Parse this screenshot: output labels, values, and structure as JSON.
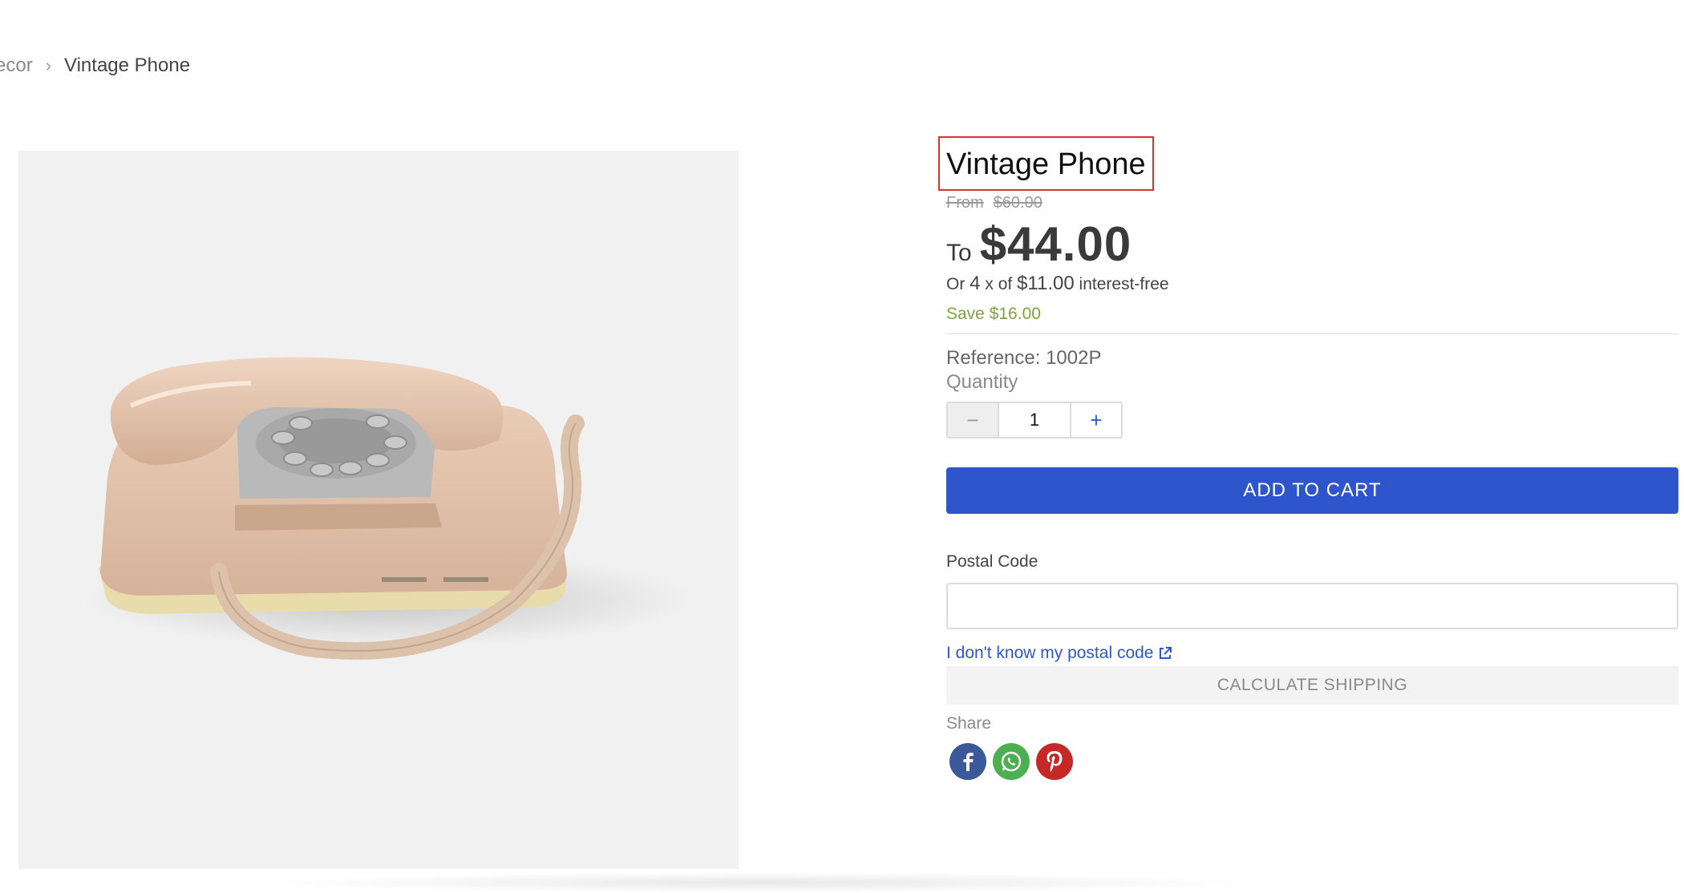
{
  "breadcrumb": {
    "previous": "ecor",
    "separator": "›",
    "current": "Vintage Phone"
  },
  "product": {
    "image_alt": "Vintage rotary phone",
    "title": "Vintage Phone",
    "price_from_label": "From",
    "price_original": "$60.00",
    "price_to_label": "To",
    "price_current": "$44.00",
    "installments": {
      "prefix": "Or",
      "count": "4",
      "times": "x of",
      "amount": "$11.00",
      "suffix": "interest-free"
    },
    "savings": "Save $16.00",
    "reference": "Reference: 1002P"
  },
  "quantity": {
    "label": "Quantity",
    "minus": "−",
    "value": "1",
    "plus": "+"
  },
  "cart": {
    "add_label": "ADD TO CART"
  },
  "shipping": {
    "postal_label": "Postal Code",
    "postal_value": "",
    "postal_placeholder": "",
    "unknown_link": "I don't know my postal code",
    "calculate_label": "CALCULATE SHIPPING"
  },
  "share": {
    "label": "Share",
    "networks": [
      "facebook-icon",
      "whatsapp-icon",
      "pinterest-icon"
    ]
  },
  "colors": {
    "accent": "#2e55cc",
    "save": "#7fa33f",
    "highlight_border": "#d9342b"
  }
}
